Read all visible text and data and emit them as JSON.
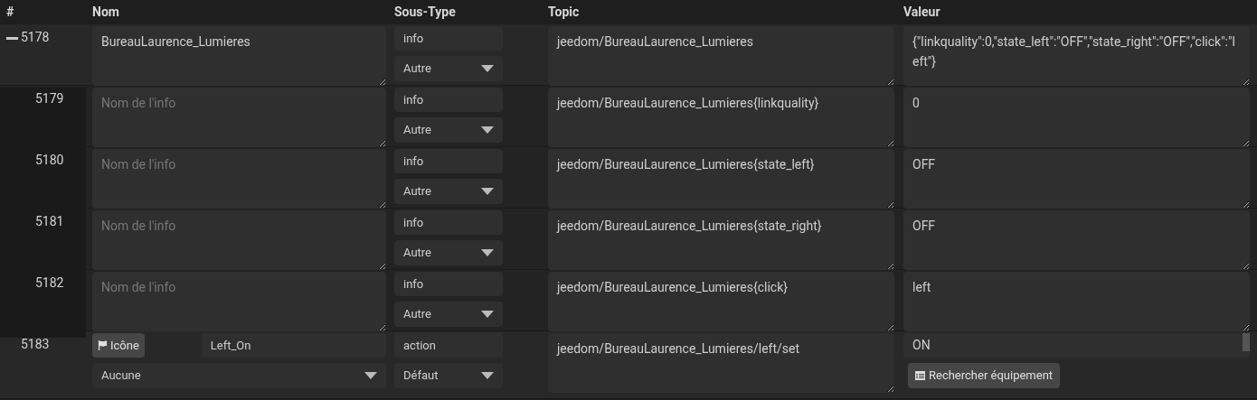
{
  "columns": [
    "#",
    "Nom",
    "Sous-Type",
    "Topic",
    "Valeur"
  ],
  "rows": [
    {
      "id": "5178",
      "kind": "info",
      "expanded": true,
      "name": "BureauLaurence_Lumieres",
      "type": "info",
      "subtype": "Autre",
      "topic": "jeedom/BureauLaurence_Lumieres",
      "value": "{\"linkquality\":0,\"state_left\":\"OFF\",\"state_right\":\"OFF\",\"click\":\"left\"}",
      "children": [
        {
          "id": "5179",
          "kind": "info",
          "name_placeholder": "Nom de l'info",
          "type": "info",
          "subtype": "Autre",
          "topic": "jeedom/BureauLaurence_Lumieres{linkquality}",
          "value": "0"
        },
        {
          "id": "5180",
          "kind": "info",
          "name_placeholder": "Nom de l'info",
          "type": "info",
          "subtype": "Autre",
          "topic": "jeedom/BureauLaurence_Lumieres{state_left}",
          "value": "OFF"
        },
        {
          "id": "5181",
          "kind": "info",
          "name_placeholder": "Nom de l'info",
          "type": "info",
          "subtype": "Autre",
          "topic": "jeedom/BureauLaurence_Lumieres{state_right}",
          "value": "OFF"
        },
        {
          "id": "5182",
          "kind": "info",
          "name_placeholder": "Nom de l'info",
          "type": "info",
          "subtype": "Autre",
          "topic": "jeedom/BureauLaurence_Lumieres{click}",
          "value": "left"
        }
      ]
    },
    {
      "id": "5183",
      "kind": "action",
      "icon_button": "Icône",
      "name": "Left_On",
      "value_select": "Aucune",
      "type": "action",
      "subtype": "Défaut",
      "topic": "jeedom/BureauLaurence_Lumieres/left/set",
      "value": "ON",
      "search_button": "Rechercher équipement"
    }
  ]
}
